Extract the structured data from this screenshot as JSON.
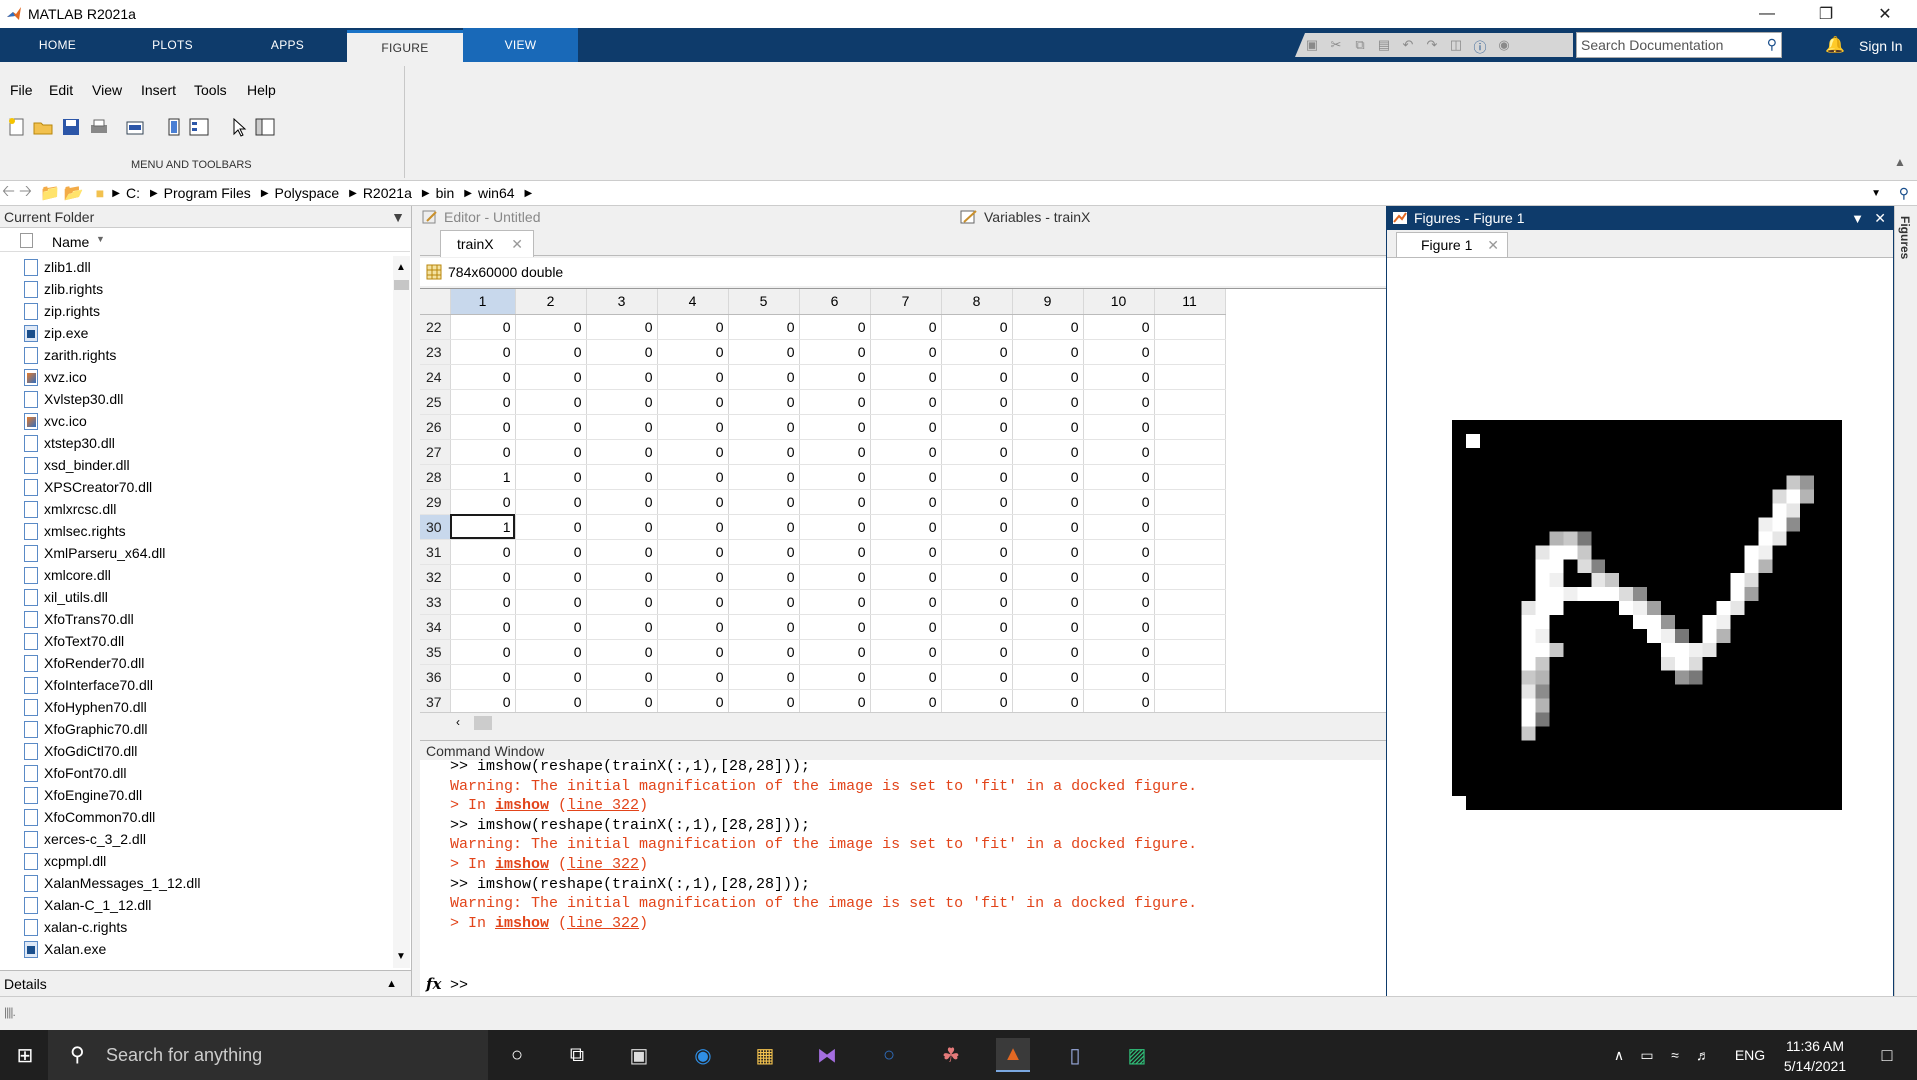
{
  "window": {
    "title": "MATLAB R2021a"
  },
  "ribbon": {
    "tabs": [
      "HOME",
      "PLOTS",
      "APPS",
      "FIGURE",
      "VIEW"
    ],
    "search_placeholder": "Search Documentation",
    "sign_in": "Sign In"
  },
  "menubar": {
    "items": [
      "File",
      "Edit",
      "View",
      "Insert",
      "Tools",
      "Help"
    ],
    "section_label": "MENU AND TOOLBARS"
  },
  "address": {
    "path": [
      "C:",
      "Program Files",
      "Polyspace",
      "R2021a",
      "bin",
      "win64"
    ]
  },
  "current_folder": {
    "title": "Current Folder",
    "column": "Name",
    "files": [
      {
        "name": "zlib1.dll",
        "type": "file"
      },
      {
        "name": "zlib.rights",
        "type": "file"
      },
      {
        "name": "zip.rights",
        "type": "file"
      },
      {
        "name": "zip.exe",
        "type": "exe"
      },
      {
        "name": "zarith.rights",
        "type": "file"
      },
      {
        "name": "xvz.ico",
        "type": "ico"
      },
      {
        "name": "Xvlstep30.dll",
        "type": "file"
      },
      {
        "name": "xvc.ico",
        "type": "ico"
      },
      {
        "name": "xtstep30.dll",
        "type": "file"
      },
      {
        "name": "xsd_binder.dll",
        "type": "file"
      },
      {
        "name": "XPSCreator70.dll",
        "type": "file"
      },
      {
        "name": "xmlxrcsc.dll",
        "type": "file"
      },
      {
        "name": "xmlsec.rights",
        "type": "file"
      },
      {
        "name": "XmlParseru_x64.dll",
        "type": "file"
      },
      {
        "name": "xmlcore.dll",
        "type": "file"
      },
      {
        "name": "xil_utils.dll",
        "type": "file"
      },
      {
        "name": "XfoTrans70.dll",
        "type": "file"
      },
      {
        "name": "XfoText70.dll",
        "type": "file"
      },
      {
        "name": "XfoRender70.dll",
        "type": "file"
      },
      {
        "name": "XfoInterface70.dll",
        "type": "file"
      },
      {
        "name": "XfoHyphen70.dll",
        "type": "file"
      },
      {
        "name": "XfoGraphic70.dll",
        "type": "file"
      },
      {
        "name": "XfoGdiCtl70.dll",
        "type": "file"
      },
      {
        "name": "XfoFont70.dll",
        "type": "file"
      },
      {
        "name": "XfoEngine70.dll",
        "type": "file"
      },
      {
        "name": "XfoCommon70.dll",
        "type": "file"
      },
      {
        "name": "xerces-c_3_2.dll",
        "type": "file"
      },
      {
        "name": "xcpmpl.dll",
        "type": "file"
      },
      {
        "name": "XalanMessages_1_12.dll",
        "type": "file"
      },
      {
        "name": "Xalan-C_1_12.dll",
        "type": "file"
      },
      {
        "name": "xalan-c.rights",
        "type": "file"
      },
      {
        "name": "Xalan.exe",
        "type": "exe"
      }
    ],
    "details_label": "Details"
  },
  "editor": {
    "title": "Editor - Untitled"
  },
  "variables": {
    "title": "Variables - trainX",
    "tab": "trainX",
    "info": "784x60000 double",
    "columns": [
      "1",
      "2",
      "3",
      "4",
      "5",
      "6",
      "7",
      "8",
      "9",
      "10",
      "11"
    ],
    "rows": [
      {
        "idx": "22",
        "vals": [
          "0",
          "0",
          "0",
          "0",
          "0",
          "0",
          "0",
          "0",
          "0",
          "0"
        ]
      },
      {
        "idx": "23",
        "vals": [
          "0",
          "0",
          "0",
          "0",
          "0",
          "0",
          "0",
          "0",
          "0",
          "0"
        ]
      },
      {
        "idx": "24",
        "vals": [
          "0",
          "0",
          "0",
          "0",
          "0",
          "0",
          "0",
          "0",
          "0",
          "0"
        ]
      },
      {
        "idx": "25",
        "vals": [
          "0",
          "0",
          "0",
          "0",
          "0",
          "0",
          "0",
          "0",
          "0",
          "0"
        ]
      },
      {
        "idx": "26",
        "vals": [
          "0",
          "0",
          "0",
          "0",
          "0",
          "0",
          "0",
          "0",
          "0",
          "0"
        ]
      },
      {
        "idx": "27",
        "vals": [
          "0",
          "0",
          "0",
          "0",
          "0",
          "0",
          "0",
          "0",
          "0",
          "0"
        ]
      },
      {
        "idx": "28",
        "vals": [
          "1",
          "0",
          "0",
          "0",
          "0",
          "0",
          "0",
          "0",
          "0",
          "0"
        ]
      },
      {
        "idx": "29",
        "vals": [
          "0",
          "0",
          "0",
          "0",
          "0",
          "0",
          "0",
          "0",
          "0",
          "0"
        ]
      },
      {
        "idx": "30",
        "vals": [
          "1",
          "0",
          "0",
          "0",
          "0",
          "0",
          "0",
          "0",
          "0",
          "0"
        ]
      },
      {
        "idx": "31",
        "vals": [
          "0",
          "0",
          "0",
          "0",
          "0",
          "0",
          "0",
          "0",
          "0",
          "0"
        ]
      },
      {
        "idx": "32",
        "vals": [
          "0",
          "0",
          "0",
          "0",
          "0",
          "0",
          "0",
          "0",
          "0",
          "0"
        ]
      },
      {
        "idx": "33",
        "vals": [
          "0",
          "0",
          "0",
          "0",
          "0",
          "0",
          "0",
          "0",
          "0",
          "0"
        ]
      },
      {
        "idx": "34",
        "vals": [
          "0",
          "0",
          "0",
          "0",
          "0",
          "0",
          "0",
          "0",
          "0",
          "0"
        ]
      },
      {
        "idx": "35",
        "vals": [
          "0",
          "0",
          "0",
          "0",
          "0",
          "0",
          "0",
          "0",
          "0",
          "0"
        ]
      },
      {
        "idx": "36",
        "vals": [
          "0",
          "0",
          "0",
          "0",
          "0",
          "0",
          "0",
          "0",
          "0",
          "0"
        ]
      },
      {
        "idx": "37",
        "vals": [
          "0",
          "0",
          "0",
          "0",
          "0",
          "0",
          "0",
          "0",
          "0",
          "0"
        ]
      }
    ],
    "selected_row": "30"
  },
  "command_window": {
    "title": "Command Window",
    "lines": [
      {
        "kind": "cmd",
        "text": ">> imshow(reshape(trainX(:,1),[28,28]));"
      },
      {
        "kind": "warn",
        "text": "Warning: The initial magnification of the image is set to 'fit' in a docked figure."
      },
      {
        "kind": "trace",
        "prefix": "> In ",
        "func": "imshow",
        "line": "line 322"
      },
      {
        "kind": "cmd",
        "text": ">> imshow(reshape(trainX(:,1),[28,28]));"
      },
      {
        "kind": "warn",
        "text": "Warning: The initial magnification of the image is set to 'fit' in a docked figure."
      },
      {
        "kind": "trace",
        "prefix": "> In ",
        "func": "imshow",
        "line": "line 322"
      },
      {
        "kind": "cmd",
        "text": ">> imshow(reshape(trainX(:,1),[28,28]));"
      },
      {
        "kind": "warn",
        "text": "Warning: The initial magnification of the image is set to 'fit' in a docked figure."
      },
      {
        "kind": "trace",
        "prefix": "> In ",
        "func": "imshow",
        "line": "line 322"
      }
    ],
    "prompt": ">>",
    "fx": "fx"
  },
  "figures": {
    "title": "Figures - Figure 1",
    "tab": "Figure 1",
    "side_label": "Figures"
  },
  "taskbar": {
    "search_placeholder": "Search for anything",
    "language": "ENG",
    "time": "11:36 AM",
    "date": "5/14/2021"
  },
  "colors": {
    "ribbon_bg": "#0e3b6b",
    "warning": "#e2441a",
    "selected_header": "#c8d8ec"
  }
}
